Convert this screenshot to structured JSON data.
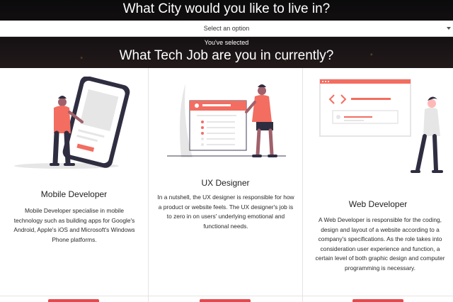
{
  "hero": {
    "city_question": "What City would you like to live in?",
    "select_placeholder": "Select an option",
    "selected_note": "You've selected",
    "job_question": "What Tech Job are you in currently?"
  },
  "cards": [
    {
      "heading": "Mobile Developer",
      "text": "Mobile Developer specialise in mobile technology such as building apps for Google's Android, Apple's iOS and Microsoft's Windows Phone platforms."
    },
    {
      "heading": "UX Designer",
      "text": "In a nutshell, the UX designer is responsible for how a product or website feels. The UX designer's job is to zero in on users' underlying emotional and functional needs."
    },
    {
      "heading": "Web Developer",
      "text": "A Web Developer is responsible for the coding, design and layout of a website according to a company's specifications. As the role takes into consideration user experience and function, a certain level of both graphic design and computer programming is necessary."
    }
  ],
  "colors": {
    "accent": "#f36d61",
    "button": "#e8474c",
    "hero_bg": "#0f0d0e"
  },
  "icons": [
    "select-arrow-icon",
    "mobile-developer-illustration",
    "ux-designer-illustration",
    "web-developer-illustration"
  ]
}
